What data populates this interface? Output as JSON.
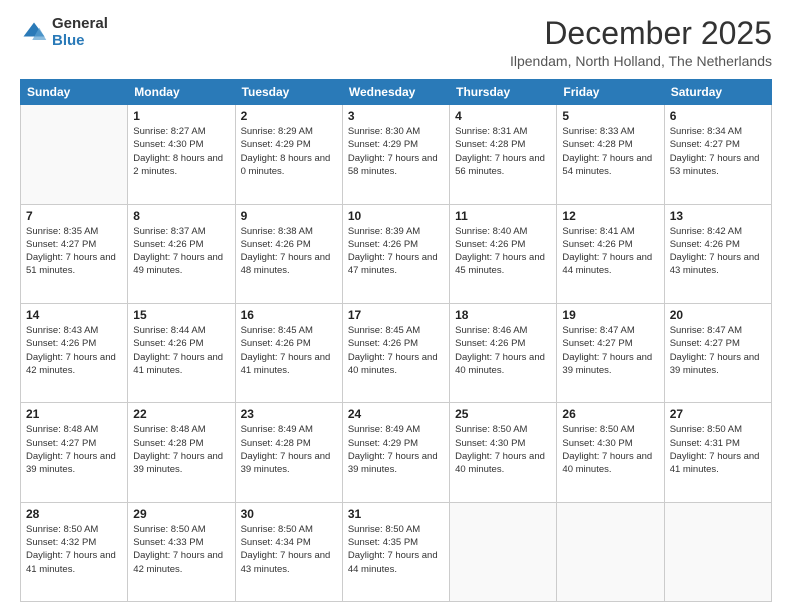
{
  "logo": {
    "general": "General",
    "blue": "Blue"
  },
  "header": {
    "month": "December 2025",
    "location": "Ilpendam, North Holland, The Netherlands"
  },
  "weekdays": [
    "Sunday",
    "Monday",
    "Tuesday",
    "Wednesday",
    "Thursday",
    "Friday",
    "Saturday"
  ],
  "weeks": [
    [
      {
        "day": "",
        "sunrise": "",
        "sunset": "",
        "daylight": ""
      },
      {
        "day": "1",
        "sunrise": "Sunrise: 8:27 AM",
        "sunset": "Sunset: 4:30 PM",
        "daylight": "Daylight: 8 hours and 2 minutes."
      },
      {
        "day": "2",
        "sunrise": "Sunrise: 8:29 AM",
        "sunset": "Sunset: 4:29 PM",
        "daylight": "Daylight: 8 hours and 0 minutes."
      },
      {
        "day": "3",
        "sunrise": "Sunrise: 8:30 AM",
        "sunset": "Sunset: 4:29 PM",
        "daylight": "Daylight: 7 hours and 58 minutes."
      },
      {
        "day": "4",
        "sunrise": "Sunrise: 8:31 AM",
        "sunset": "Sunset: 4:28 PM",
        "daylight": "Daylight: 7 hours and 56 minutes."
      },
      {
        "day": "5",
        "sunrise": "Sunrise: 8:33 AM",
        "sunset": "Sunset: 4:28 PM",
        "daylight": "Daylight: 7 hours and 54 minutes."
      },
      {
        "day": "6",
        "sunrise": "Sunrise: 8:34 AM",
        "sunset": "Sunset: 4:27 PM",
        "daylight": "Daylight: 7 hours and 53 minutes."
      }
    ],
    [
      {
        "day": "7",
        "sunrise": "Sunrise: 8:35 AM",
        "sunset": "Sunset: 4:27 PM",
        "daylight": "Daylight: 7 hours and 51 minutes."
      },
      {
        "day": "8",
        "sunrise": "Sunrise: 8:37 AM",
        "sunset": "Sunset: 4:26 PM",
        "daylight": "Daylight: 7 hours and 49 minutes."
      },
      {
        "day": "9",
        "sunrise": "Sunrise: 8:38 AM",
        "sunset": "Sunset: 4:26 PM",
        "daylight": "Daylight: 7 hours and 48 minutes."
      },
      {
        "day": "10",
        "sunrise": "Sunrise: 8:39 AM",
        "sunset": "Sunset: 4:26 PM",
        "daylight": "Daylight: 7 hours and 47 minutes."
      },
      {
        "day": "11",
        "sunrise": "Sunrise: 8:40 AM",
        "sunset": "Sunset: 4:26 PM",
        "daylight": "Daylight: 7 hours and 45 minutes."
      },
      {
        "day": "12",
        "sunrise": "Sunrise: 8:41 AM",
        "sunset": "Sunset: 4:26 PM",
        "daylight": "Daylight: 7 hours and 44 minutes."
      },
      {
        "day": "13",
        "sunrise": "Sunrise: 8:42 AM",
        "sunset": "Sunset: 4:26 PM",
        "daylight": "Daylight: 7 hours and 43 minutes."
      }
    ],
    [
      {
        "day": "14",
        "sunrise": "Sunrise: 8:43 AM",
        "sunset": "Sunset: 4:26 PM",
        "daylight": "Daylight: 7 hours and 42 minutes."
      },
      {
        "day": "15",
        "sunrise": "Sunrise: 8:44 AM",
        "sunset": "Sunset: 4:26 PM",
        "daylight": "Daylight: 7 hours and 41 minutes."
      },
      {
        "day": "16",
        "sunrise": "Sunrise: 8:45 AM",
        "sunset": "Sunset: 4:26 PM",
        "daylight": "Daylight: 7 hours and 41 minutes."
      },
      {
        "day": "17",
        "sunrise": "Sunrise: 8:45 AM",
        "sunset": "Sunset: 4:26 PM",
        "daylight": "Daylight: 7 hours and 40 minutes."
      },
      {
        "day": "18",
        "sunrise": "Sunrise: 8:46 AM",
        "sunset": "Sunset: 4:26 PM",
        "daylight": "Daylight: 7 hours and 40 minutes."
      },
      {
        "day": "19",
        "sunrise": "Sunrise: 8:47 AM",
        "sunset": "Sunset: 4:27 PM",
        "daylight": "Daylight: 7 hours and 39 minutes."
      },
      {
        "day": "20",
        "sunrise": "Sunrise: 8:47 AM",
        "sunset": "Sunset: 4:27 PM",
        "daylight": "Daylight: 7 hours and 39 minutes."
      }
    ],
    [
      {
        "day": "21",
        "sunrise": "Sunrise: 8:48 AM",
        "sunset": "Sunset: 4:27 PM",
        "daylight": "Daylight: 7 hours and 39 minutes."
      },
      {
        "day": "22",
        "sunrise": "Sunrise: 8:48 AM",
        "sunset": "Sunset: 4:28 PM",
        "daylight": "Daylight: 7 hours and 39 minutes."
      },
      {
        "day": "23",
        "sunrise": "Sunrise: 8:49 AM",
        "sunset": "Sunset: 4:28 PM",
        "daylight": "Daylight: 7 hours and 39 minutes."
      },
      {
        "day": "24",
        "sunrise": "Sunrise: 8:49 AM",
        "sunset": "Sunset: 4:29 PM",
        "daylight": "Daylight: 7 hours and 39 minutes."
      },
      {
        "day": "25",
        "sunrise": "Sunrise: 8:50 AM",
        "sunset": "Sunset: 4:30 PM",
        "daylight": "Daylight: 7 hours and 40 minutes."
      },
      {
        "day": "26",
        "sunrise": "Sunrise: 8:50 AM",
        "sunset": "Sunset: 4:30 PM",
        "daylight": "Daylight: 7 hours and 40 minutes."
      },
      {
        "day": "27",
        "sunrise": "Sunrise: 8:50 AM",
        "sunset": "Sunset: 4:31 PM",
        "daylight": "Daylight: 7 hours and 41 minutes."
      }
    ],
    [
      {
        "day": "28",
        "sunrise": "Sunrise: 8:50 AM",
        "sunset": "Sunset: 4:32 PM",
        "daylight": "Daylight: 7 hours and 41 minutes."
      },
      {
        "day": "29",
        "sunrise": "Sunrise: 8:50 AM",
        "sunset": "Sunset: 4:33 PM",
        "daylight": "Daylight: 7 hours and 42 minutes."
      },
      {
        "day": "30",
        "sunrise": "Sunrise: 8:50 AM",
        "sunset": "Sunset: 4:34 PM",
        "daylight": "Daylight: 7 hours and 43 minutes."
      },
      {
        "day": "31",
        "sunrise": "Sunrise: 8:50 AM",
        "sunset": "Sunset: 4:35 PM",
        "daylight": "Daylight: 7 hours and 44 minutes."
      },
      {
        "day": "",
        "sunrise": "",
        "sunset": "",
        "daylight": ""
      },
      {
        "day": "",
        "sunrise": "",
        "sunset": "",
        "daylight": ""
      },
      {
        "day": "",
        "sunrise": "",
        "sunset": "",
        "daylight": ""
      }
    ]
  ]
}
